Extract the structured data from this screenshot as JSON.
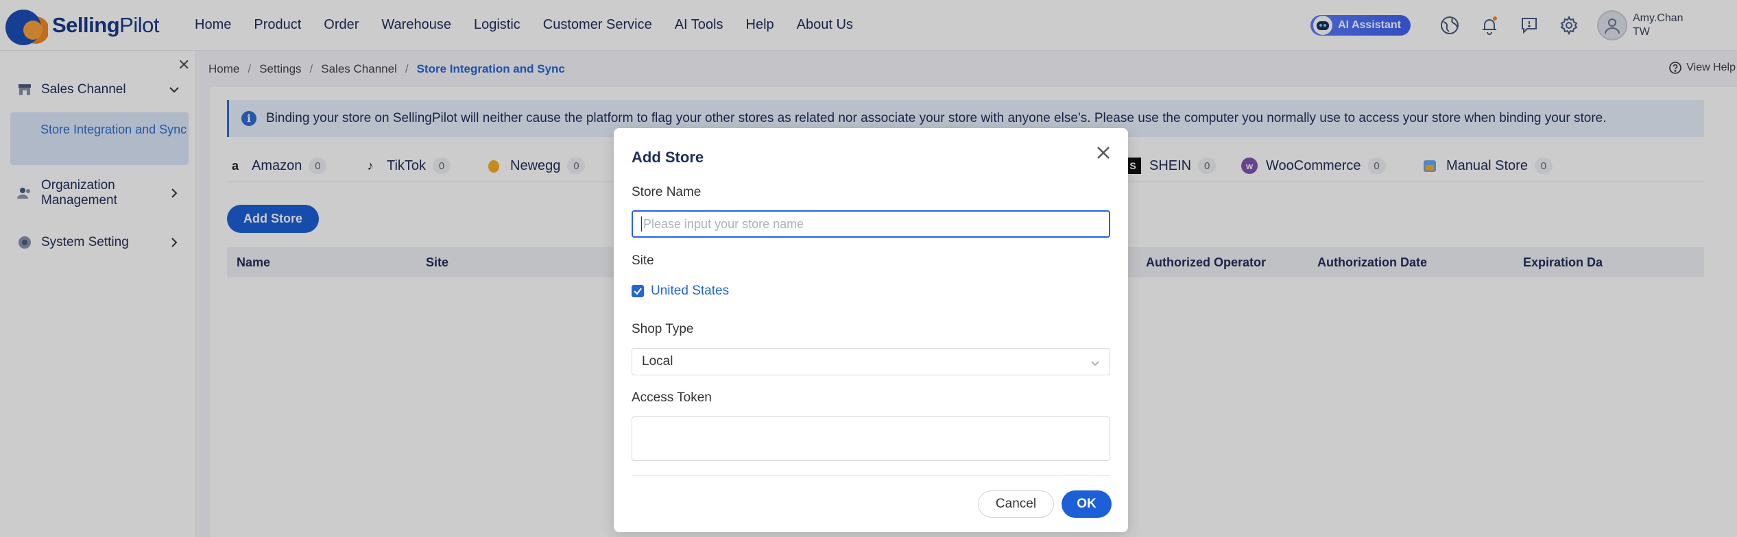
{
  "app": {
    "logo_bold": "Selling",
    "logo_regular": "Pilot"
  },
  "nav": {
    "items": [
      "Home",
      "Product",
      "Order",
      "Warehouse",
      "Logistic",
      "Customer Service",
      "AI Tools",
      "Help",
      "About Us"
    ]
  },
  "topbar": {
    "ai_assistant": "AI Assistant",
    "user_name": "Amy.Chan",
    "user_region": "TW",
    "notification_dot_color": "#f08a24"
  },
  "sidebar": {
    "sales_channel": "Sales Channel",
    "store_integration": "Store Integration and Sync",
    "organization_management": "Organization Management",
    "system_setting": "System Setting"
  },
  "breadcrumb": {
    "home": "Home",
    "settings": "Settings",
    "sales_channel": "Sales Channel",
    "current": "Store Integration and Sync"
  },
  "view_help": "View Help",
  "banner_text": "Binding your store on SellingPilot will neither cause the platform to flag your other stores as related nor associate your store with anyone else’s. Please use the computer you normally use to access your store when binding your store.",
  "tabs": [
    {
      "label": "Amazon",
      "count": "0"
    },
    {
      "label": "TikTok",
      "count": "0"
    },
    {
      "label": "Newegg",
      "count": "0"
    },
    {
      "label": "SHEIN",
      "count": "0"
    },
    {
      "label": "WooCommerce",
      "count": "0"
    },
    {
      "label": "Manual Store",
      "count": "0"
    }
  ],
  "add_store_button": "Add Store",
  "table": {
    "columns": [
      "Name",
      "Site",
      "Authorized Operator",
      "Authorization Date",
      "Expiration Da"
    ]
  },
  "modal": {
    "title": "Add Store",
    "store_name_label": "Store Name",
    "store_name_placeholder": "Please input your store name",
    "site_label": "Site",
    "site_option": "United States",
    "site_checked": true,
    "shop_type_label": "Shop Type",
    "shop_type_value": "Local",
    "access_token_label": "Access Token",
    "cancel": "Cancel",
    "ok": "OK"
  },
  "colors": {
    "primary": "#1c5fd6",
    "accent_blue": "#2466d6",
    "brand_orange": "#f08a24"
  }
}
